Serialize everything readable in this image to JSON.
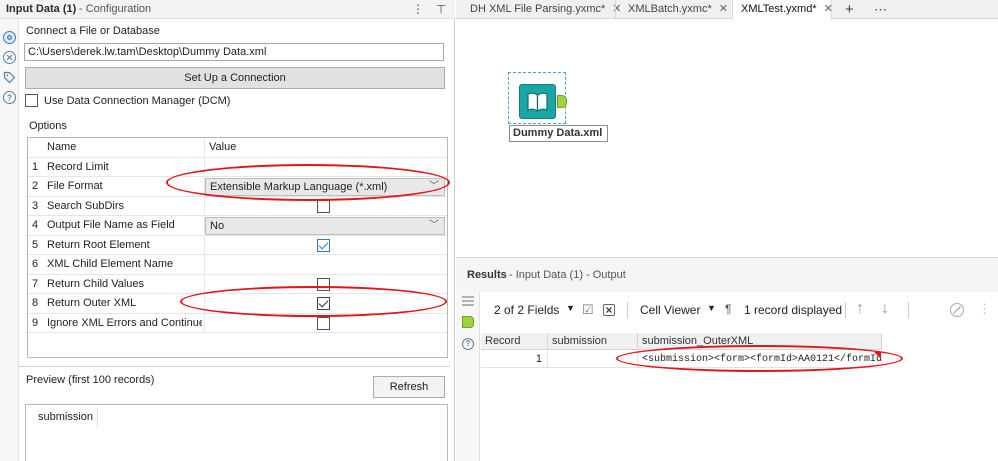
{
  "config_panel": {
    "title": "Input Data (1)",
    "subtitle": "- Configuration",
    "menu_glyph": "⋮",
    "pin_glyph": "⊥",
    "connect_label": "Connect a File or Database",
    "file_path": "C:\\Users\\derek.lw.tam\\Desktop\\Dummy Data.xml",
    "setup_button": "Set Up a Connection",
    "dcm_label": "Use Data Connection Manager (DCM)",
    "dcm_checked": false,
    "options_label": "Options",
    "grid_headers": {
      "name": "Name",
      "value": "Value"
    },
    "options": [
      {
        "num": "1",
        "name": "Record Limit",
        "value": ""
      },
      {
        "num": "2",
        "name": "File Format",
        "value": "Extensible Markup Language (*.xml)"
      },
      {
        "num": "3",
        "name": "Search SubDirs",
        "checked": false
      },
      {
        "num": "4",
        "name": "Output File Name as Field",
        "value": "No"
      },
      {
        "num": "5",
        "name": "Return Root Element",
        "checked": true
      },
      {
        "num": "6",
        "name": "XML Child Element Name",
        "value": ""
      },
      {
        "num": "7",
        "name": "Return Child Values",
        "checked": false
      },
      {
        "num": "8",
        "name": "Return Outer XML",
        "checked": true
      },
      {
        "num": "9",
        "name": "Ignore XML Errors and Continue",
        "checked": false
      }
    ],
    "preview_label": "Preview (first 100 records)",
    "refresh_button": "Refresh",
    "preview_column": "submission"
  },
  "tabs": [
    {
      "label": "DH XML File Parsing.yxmc*",
      "close": "✕",
      "active": false
    },
    {
      "label": "XMLBatch.yxmc*",
      "close": "✕",
      "active": false
    },
    {
      "label": "XMLTest.yxmd*",
      "close": "✕",
      "active": true
    }
  ],
  "tab_actions": {
    "add": "+",
    "more": "⋯"
  },
  "canvas": {
    "tool_label": "Dummy Data.xml",
    "tool_icon": "book-icon",
    "tool_color": "#1ba6a6"
  },
  "results": {
    "title": "Results",
    "subtitle": "- Input Data (1) - Output",
    "fields_label": "2 of 2 Fields",
    "cell_viewer_label": "Cell Viewer",
    "records_label": "1 record displayed",
    "columns": [
      "Record",
      "submission",
      "submission_OuterXML"
    ],
    "rows": [
      {
        "record": "1",
        "submission": "",
        "outer_xml": "<submission><form><formId>AA0121</formId..."
      }
    ]
  },
  "colors": {
    "annotation_red": "#e0161b",
    "selection_blue": "#5b9bd5",
    "check_blue": "#2f7bc2"
  }
}
